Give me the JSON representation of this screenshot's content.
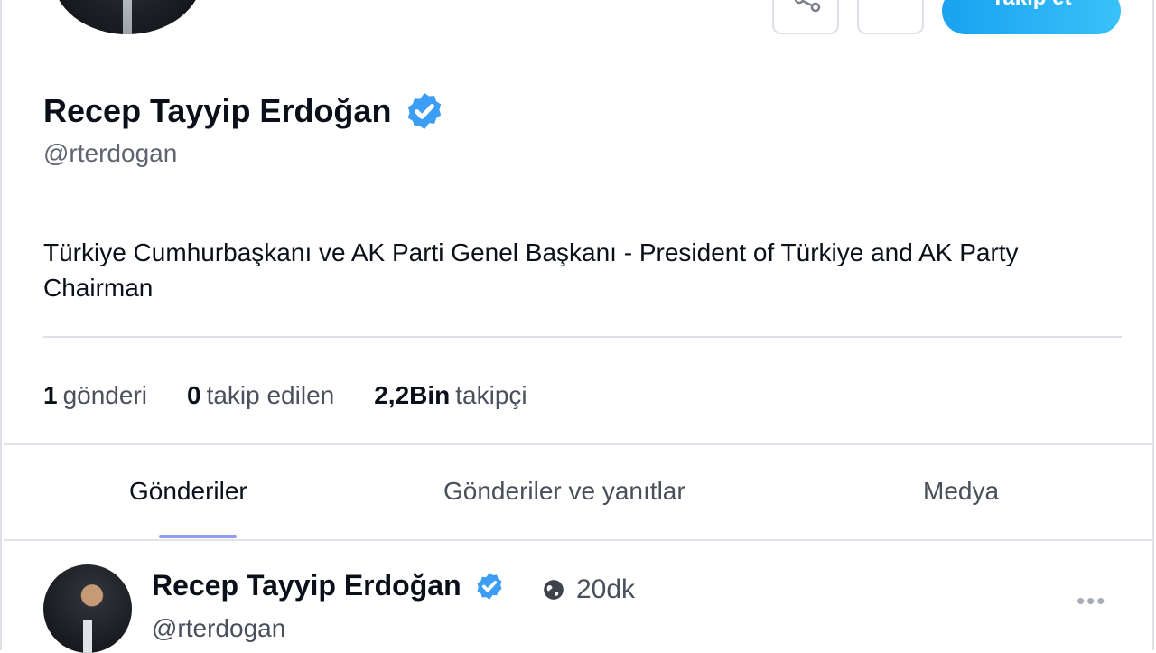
{
  "header": {
    "follow_label": "Takip et",
    "more_label": "•••"
  },
  "profile": {
    "name": "Recep Tayyip Erdoğan",
    "handle": "@rterdogan",
    "bio": "Türkiye Cumhurbaşkanı ve AK Parti Genel Başkanı - President of Türkiye and AK Party Chairman",
    "verified_color": "#3b9ef4",
    "accent_color": "#18a2f0"
  },
  "stats": [
    {
      "value": "1",
      "label": "gönderi"
    },
    {
      "value": "0",
      "label": "takip edilen"
    },
    {
      "value": "2,2Bin",
      "label": "takipçi"
    }
  ],
  "tabs": [
    {
      "label": "Gönderiler",
      "active": true
    },
    {
      "label": "Gönderiler ve yanıtlar",
      "active": false
    },
    {
      "label": "Medya",
      "active": false
    }
  ],
  "post": {
    "name": "Recep Tayyip Erdoğan",
    "handle": "@rterdogan",
    "time": "20dk",
    "audience_icon": "globe-icon",
    "more_label": "•••"
  }
}
